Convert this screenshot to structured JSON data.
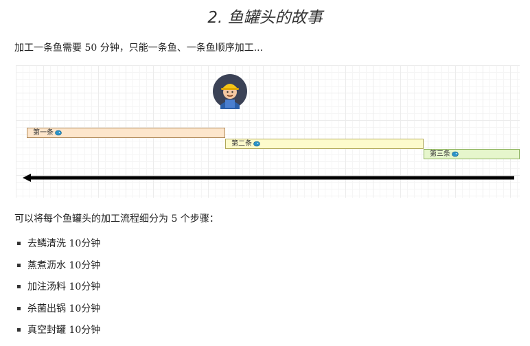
{
  "page": {
    "title": "2. 鱼罐头的故事",
    "intro": "加工一条鱼需要 50 分钟，只能一条鱼、一条鱼顺序加工...",
    "paragraph": "可以将每个鱼罐头的加工流程细分为 5 个步骤："
  },
  "timeline": {
    "worker_icon": "worker-avatar-icon",
    "fish_icon": "fish-icon",
    "bars": [
      {
        "label": "第一条"
      },
      {
        "label": "第二条"
      },
      {
        "label": "第三条"
      }
    ]
  },
  "steps": [
    {
      "text": "去鳞清洗 10分钟"
    },
    {
      "text": "蒸煮沥水 10分钟"
    },
    {
      "text": "加注汤料 10分钟"
    },
    {
      "text": "杀菌出锅 10分钟"
    },
    {
      "text": "真空封罐 10分钟"
    }
  ],
  "colors": {
    "bar1": "#fde6cc",
    "bar2": "#fdfbcc",
    "bar3": "#e6f6cc",
    "arrow": "#000000"
  }
}
